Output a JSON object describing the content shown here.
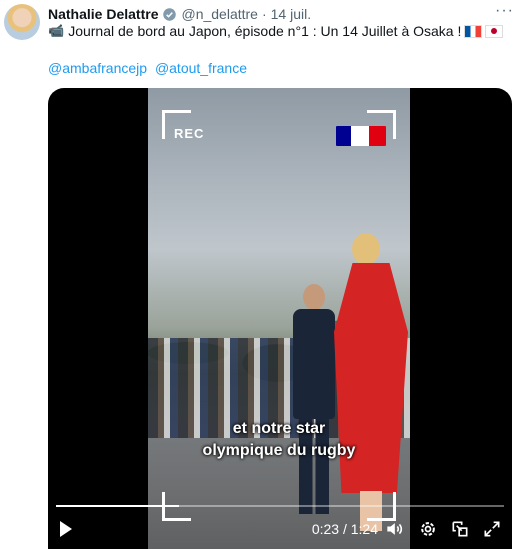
{
  "tweet": {
    "author_name": "Nathalie Delattre",
    "handle": "@n_delattre",
    "separator": "·",
    "date": "14 juil.",
    "more_label": "···",
    "text": "Journal de bord au Japon, épisode n°1 : Un 14 Juillet à Osaka !",
    "text_prefix_emoji": "📹",
    "mentions": [
      "@ambafrancejp",
      "@atout_france"
    ]
  },
  "video": {
    "overlay_label": "REC",
    "caption_line1": "et notre star",
    "caption_line2": "olympique du rugby",
    "time_display": "0:23 / 1:24",
    "progress_fraction": 0.274
  },
  "colors": {
    "link": "#1d9bf0",
    "secondary_text": "#536471",
    "dress_red": "#d42424"
  },
  "icons": [
    "verified-badge-icon",
    "more-icon",
    "video-camera-icon",
    "play-icon",
    "volume-icon",
    "settings-icon",
    "pip-icon",
    "fullscreen-icon"
  ]
}
